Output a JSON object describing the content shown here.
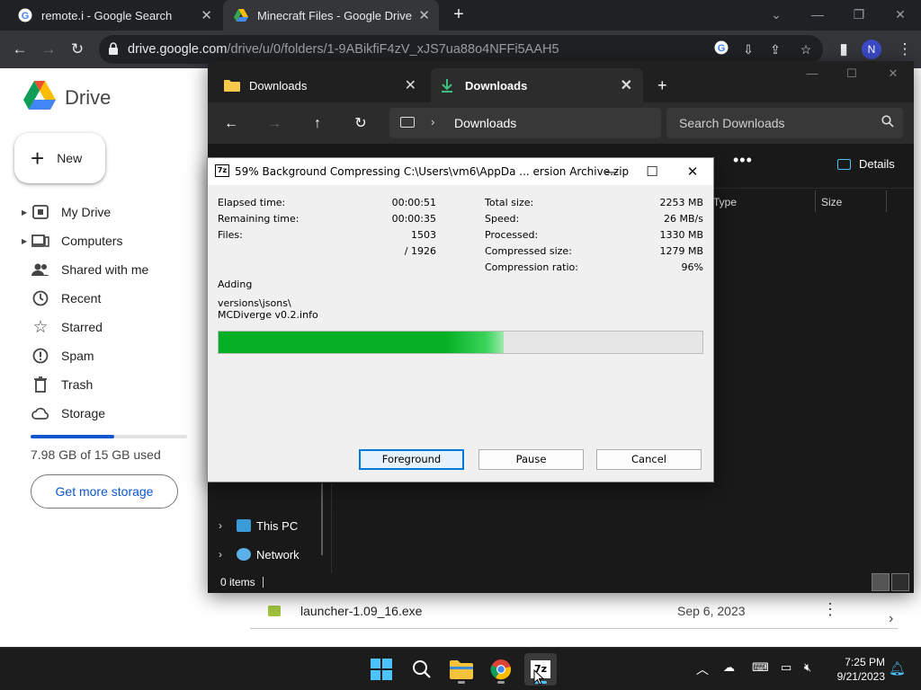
{
  "browser": {
    "tabs": [
      {
        "title": "remote.i - Google Search",
        "active": false
      },
      {
        "title": "Minecraft Files - Google Drive",
        "active": true
      }
    ],
    "url_host": "drive.google.com",
    "url_path": "/drive/u/0/folders/1-9ABikfiF4zV_xJS7ua88o4NFFi5AAH5",
    "avatar_initial": "N"
  },
  "drive": {
    "title": "Drive",
    "new_label": "New",
    "nav": [
      {
        "label": "My Drive",
        "icon": "my-drive-icon",
        "expandable": true
      },
      {
        "label": "Computers",
        "icon": "computers-icon",
        "expandable": true
      },
      {
        "label": "Shared with me",
        "icon": "shared-icon",
        "expandable": false
      },
      {
        "label": "Recent",
        "icon": "clock-icon",
        "expandable": false
      },
      {
        "label": "Starred",
        "icon": "star-icon",
        "expandable": false
      },
      {
        "label": "Spam",
        "icon": "spam-icon",
        "expandable": false
      },
      {
        "label": "Trash",
        "icon": "trash-icon",
        "expandable": false
      },
      {
        "label": "Storage",
        "icon": "cloud-icon",
        "expandable": false
      }
    ],
    "storage_used_fraction": 0.532,
    "storage_text": "7.98 GB of 15 GB used",
    "get_more_storage": "Get more storage",
    "file": {
      "name": "launcher-1.09_16.exe",
      "date": "Sep 6, 2023"
    }
  },
  "explorer": {
    "tabs": [
      {
        "title": "Downloads",
        "active": false
      },
      {
        "title": "Downloads",
        "active": true
      }
    ],
    "path": "Downloads",
    "search_placeholder": "Search Downloads",
    "details_label": "Details",
    "columns": [
      "Type",
      "Size"
    ],
    "tree": [
      {
        "label": "This PC",
        "icon": "this-pc-icon"
      },
      {
        "label": "Network",
        "icon": "network-icon"
      }
    ],
    "status": "0 items"
  },
  "dialog": {
    "title": "59% Background Compressing C:\\Users\\vm6\\AppDa ... ersion Archive.zip",
    "left_stats": [
      {
        "label": "Elapsed time:",
        "value": "00:00:51"
      },
      {
        "label": "Remaining time:",
        "value": "00:00:35"
      },
      {
        "label": "Files:",
        "value": "1503"
      },
      {
        "label": "",
        "value": "/ 1926"
      }
    ],
    "right_stats": [
      {
        "label": "Total size:",
        "value": "2253 MB"
      },
      {
        "label": "Speed:",
        "value": "26 MB/s"
      },
      {
        "label": "Processed:",
        "value": "1330 MB"
      },
      {
        "label": "Compressed size:",
        "value": "1279 MB"
      },
      {
        "label": "Compression ratio:",
        "value": "96%"
      }
    ],
    "action": "Adding",
    "current_dir": "versions\\jsons\\",
    "current_file": "MCDiverge v0.2.info",
    "progress": 0.59,
    "buttons": {
      "foreground": "Foreground",
      "pause": "Pause",
      "cancel": "Cancel"
    }
  },
  "taskbar": {
    "time": "7:25 PM",
    "date": "9/21/2023"
  },
  "colors": {
    "progress_green": "#06b025",
    "drive_blue": "#0b57d0",
    "explorer_bg": "#191919"
  }
}
